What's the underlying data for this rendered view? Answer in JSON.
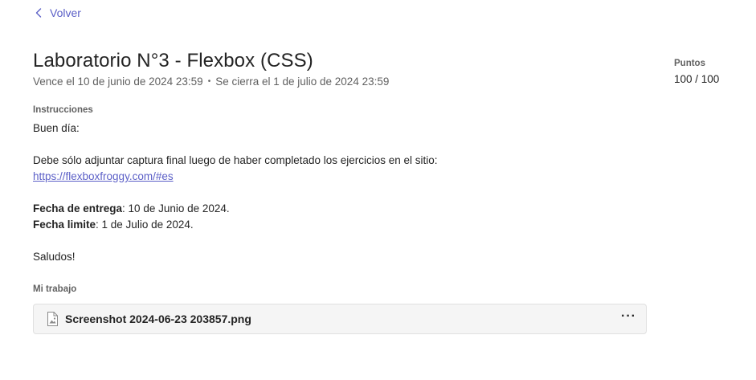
{
  "nav": {
    "back_label": "Volver"
  },
  "assignment": {
    "title": "Laboratorio N°3 - Flexbox (CSS)",
    "due": "Vence el 10 de junio de 2024 23:59",
    "separator": "•",
    "closes": "Se cierra el 1 de julio de 2024 23:59"
  },
  "points": {
    "label": "Puntos",
    "value": "100 / 100"
  },
  "instructions": {
    "label": "Instrucciones",
    "greeting": "Buen día:",
    "body": "Debe sólo adjuntar captura final luego  de haber completado los ejercicios en el sitio:",
    "link": "https://flexboxfroggy.com/#es",
    "delivery_label": "Fecha de entrega",
    "delivery_value": ": 10 de Junio de 2024.",
    "limit_label": "Fecha limite",
    "limit_value": ": 1 de Julio de 2024.",
    "closing": "Saludos!"
  },
  "my_work": {
    "label": "Mi trabajo",
    "file_name": "Screenshot 2024-06-23 203857.png",
    "more_label": "···"
  },
  "colors": {
    "accent": "#5b5fc7",
    "muted": "#616161",
    "text": "#242424"
  }
}
